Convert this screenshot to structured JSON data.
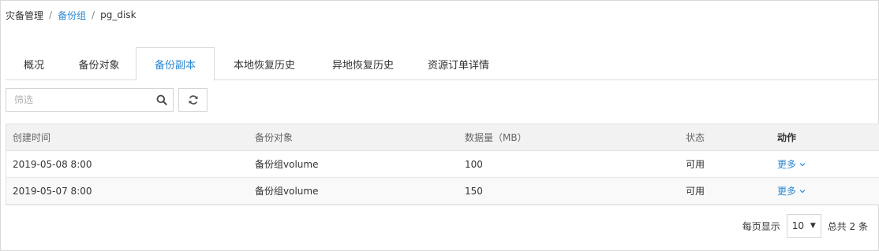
{
  "breadcrumb": {
    "items": [
      {
        "label": "灾备管理",
        "link": false
      },
      {
        "label": "备份组",
        "link": true
      },
      {
        "label": "pg_disk",
        "link": false
      }
    ],
    "separator": "/"
  },
  "tabs": [
    {
      "label": "概况",
      "active": false
    },
    {
      "label": "备份对象",
      "active": false
    },
    {
      "label": "备份副本",
      "active": true
    },
    {
      "label": "本地恢复历史",
      "active": false
    },
    {
      "label": "异地恢复历史",
      "active": false
    },
    {
      "label": "资源订单详情",
      "active": false
    }
  ],
  "toolbar": {
    "filter_placeholder": "筛选",
    "filter_value": "",
    "search_icon": "search-icon",
    "refresh_icon": "refresh-icon"
  },
  "table": {
    "columns": [
      "创建时间",
      "备份对象",
      "数据量（MB）",
      "状态",
      "动作"
    ],
    "rows": [
      {
        "created": "2019-05-08 8:00",
        "object": "备份组volume",
        "size": "100",
        "status": "可用",
        "action": "更多"
      },
      {
        "created": "2019-05-07 8:00",
        "object": "备份组volume",
        "size": "150",
        "status": "可用",
        "action": "更多"
      }
    ]
  },
  "pagination": {
    "per_page_label": "每页显示",
    "page_size": "10",
    "total_label": "总共 2 条"
  },
  "colors": {
    "accent": "#2b87d1",
    "header_bg": "#f2f2f2",
    "border": "#dcdcdc"
  }
}
